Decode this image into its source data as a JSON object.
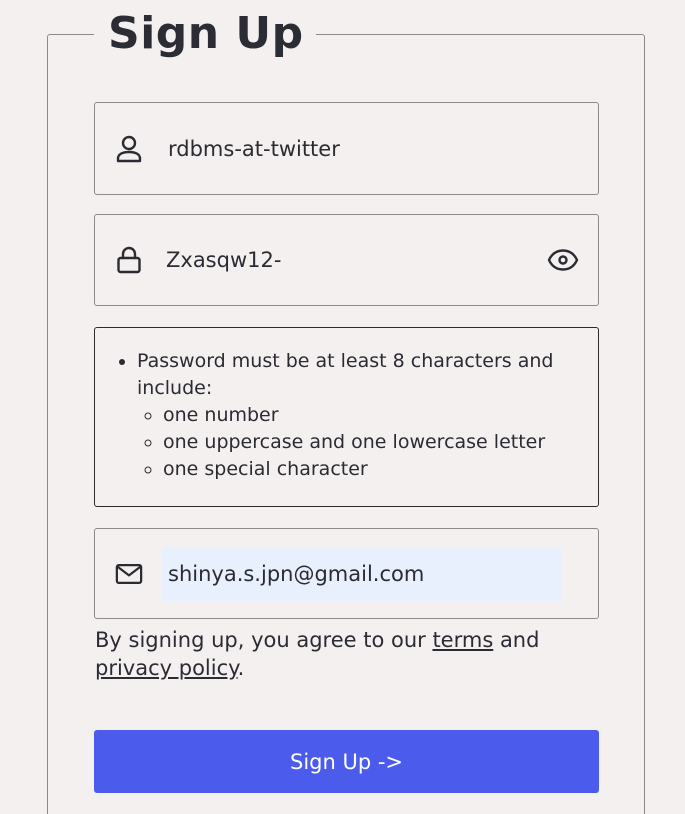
{
  "form": {
    "title": "Sign Up",
    "username": {
      "icon": "user-icon",
      "value": "rdbms-at-twitter"
    },
    "password": {
      "icon": "lock-icon",
      "value": "Zxasqw12-",
      "toggle_icon": "eye-icon"
    },
    "password_rules": {
      "intro": "Password must be at least 8 characters and include:",
      "items": [
        "one number",
        "one uppercase and one lowercase letter",
        "one special character"
      ]
    },
    "email": {
      "icon": "mail-icon",
      "value": "shinya.s.jpn@gmail.com",
      "autofill_color": "#e8f0fd"
    },
    "agreement": {
      "prefix": "By signing up, you agree to our ",
      "terms_link": "terms",
      "middle": " and ",
      "privacy_link": "privacy policy",
      "suffix": "."
    },
    "submit_label": "Sign Up ->",
    "accent_color": "#4b5ced"
  }
}
